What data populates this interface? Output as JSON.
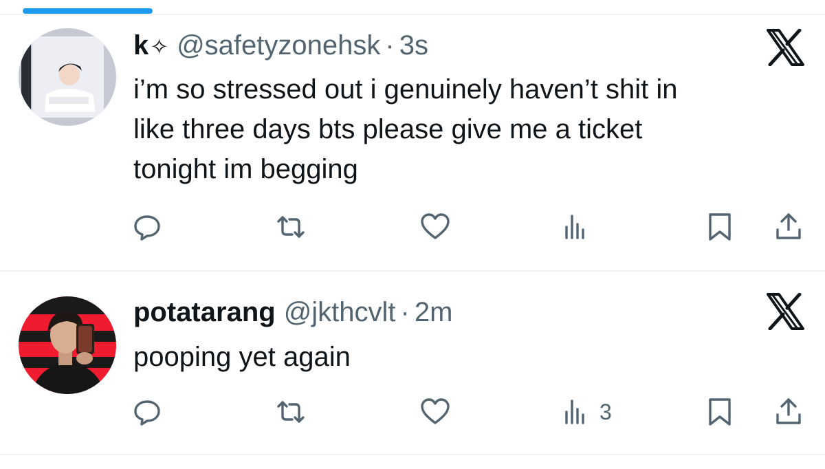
{
  "theme": {
    "accent": "#1d9bf0",
    "text": "#0f1419",
    "muted": "#536471",
    "divider": "#eff3f4"
  },
  "tweets": [
    {
      "name": "k",
      "badge": "✧",
      "handle": "@safetyzonehsk",
      "separator": "·",
      "time": "3s",
      "text": "i’m so stressed out i genuinely haven’t shit in\nlike three days bts please give me a ticket\ntonight im begging",
      "views": "",
      "icons": {
        "avatar": "avatar-photo",
        "logo": "x-logo-icon",
        "reply": "reply-icon",
        "retweet": "retweet-icon",
        "like": "heart-icon",
        "views": "views-icon",
        "bookmark": "bookmark-icon",
        "share": "share-icon"
      }
    },
    {
      "name": "potatarang",
      "badge": "",
      "handle": "@jkthcvlt",
      "separator": "·",
      "time": "2m",
      "text": "pooping yet again",
      "views": "3",
      "icons": {
        "avatar": "avatar-photo",
        "logo": "x-logo-icon",
        "reply": "reply-icon",
        "retweet": "retweet-icon",
        "like": "heart-icon",
        "views": "views-icon",
        "bookmark": "bookmark-icon",
        "share": "share-icon"
      }
    }
  ]
}
